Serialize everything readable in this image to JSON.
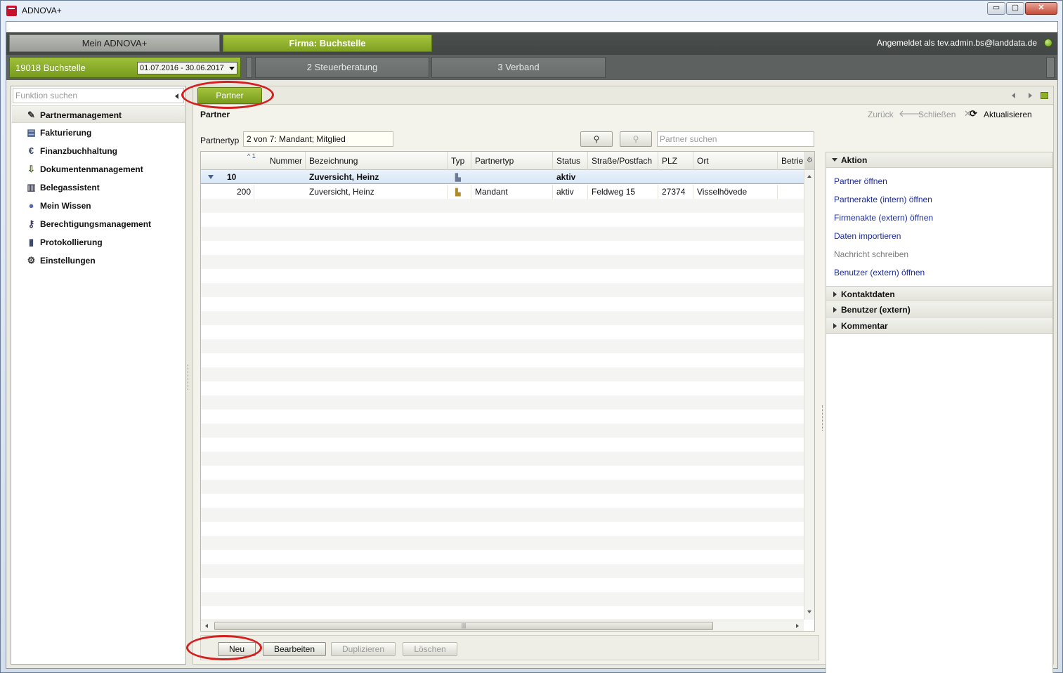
{
  "window": {
    "title": "ADNOVA+",
    "controls": {
      "minimize": "▭",
      "maximize": "▢",
      "close": "✕"
    }
  },
  "topbar": {
    "tabs": [
      {
        "label": "Mein ADNOVA+"
      },
      {
        "label": "Firma: Buchstelle"
      }
    ],
    "login": "Angemeldet als tev.admin.bs@landdata.de",
    "status_color": "#6fae17"
  },
  "context": {
    "company": "19018 Buchstelle",
    "period": "01.07.2016 - 30.06.2017",
    "tabs": [
      {
        "label": "2 Steuerberatung"
      },
      {
        "label": "3 Verband"
      }
    ]
  },
  "sidebar": {
    "search_placeholder": "Funktion suchen",
    "items": [
      {
        "label": "Partnermanagement",
        "icon": "pencil-icon",
        "glyph": "✎",
        "selected": true
      },
      {
        "label": "Fakturierung",
        "icon": "invoice-icon",
        "glyph": "▤"
      },
      {
        "label": "Finanzbuchhaltung",
        "icon": "euro-icon",
        "glyph": "€"
      },
      {
        "label": "Dokumentenmanagement",
        "icon": "document-download-icon",
        "glyph": "⇩"
      },
      {
        "label": "Belegassistent",
        "icon": "receipt-icon",
        "glyph": "▥"
      },
      {
        "label": "Mein Wissen",
        "icon": "lightbulb-icon",
        "glyph": "●"
      },
      {
        "label": "Berechtigungsmanagement",
        "icon": "user-key-icon",
        "glyph": "⚷"
      },
      {
        "label": "Protokollierung",
        "icon": "clipboard-icon",
        "glyph": "▮"
      },
      {
        "label": "Einstellungen",
        "icon": "gear-icon",
        "glyph": "⚙"
      }
    ]
  },
  "main": {
    "tab": "Partner",
    "title": "Partner",
    "toolbar": {
      "back": "Zurück",
      "close": "Schließen",
      "refresh": "Aktualisieren"
    },
    "filter": {
      "label": "Partnertyp",
      "value": "2 von 7: Mandant; Mitglied"
    },
    "search_placeholder": "Partner suchen",
    "table": {
      "sort_marker": "^ 1",
      "columns": [
        "Nummer",
        "Bezeichnung",
        "Typ",
        "Partnertyp",
        "Status",
        "Straße/Postfach",
        "PLZ",
        "Ort",
        "Betrie"
      ],
      "group_row": {
        "nummer": "10",
        "bezeichnung": "Zuversicht, Heinz",
        "status": "aktiv"
      },
      "rows": [
        {
          "nummer": "200",
          "bezeichnung": "Zuversicht, Heinz",
          "partnertyp": "Mandant",
          "status": "aktiv",
          "strasse": "Feldweg 15",
          "plz": "27374",
          "ort": "Visselhövede"
        }
      ]
    },
    "actions": {
      "neu": "Neu",
      "bearbeiten": "Bearbeiten",
      "duplizieren": "Duplizieren",
      "loeschen": "Löschen"
    }
  },
  "right_pane": {
    "aktion_title": "Aktion",
    "links": [
      {
        "label": "Partner öffnen",
        "enabled": true
      },
      {
        "label": "Partnerakte (intern) öffnen",
        "enabled": true
      },
      {
        "label": "Firmenakte (extern) öffnen",
        "enabled": true
      },
      {
        "label": "Daten importieren",
        "enabled": true
      },
      {
        "label": "Nachricht schreiben",
        "enabled": false
      },
      {
        "label": "Benutzer (extern) öffnen",
        "enabled": true
      }
    ],
    "sections": [
      "Kontaktdaten",
      "Benutzer (extern)",
      "Kommentar"
    ]
  },
  "colors": {
    "accent_green": "#8fb127",
    "link_blue": "#1d2c9a",
    "highlight_red": "#d51e1e"
  }
}
